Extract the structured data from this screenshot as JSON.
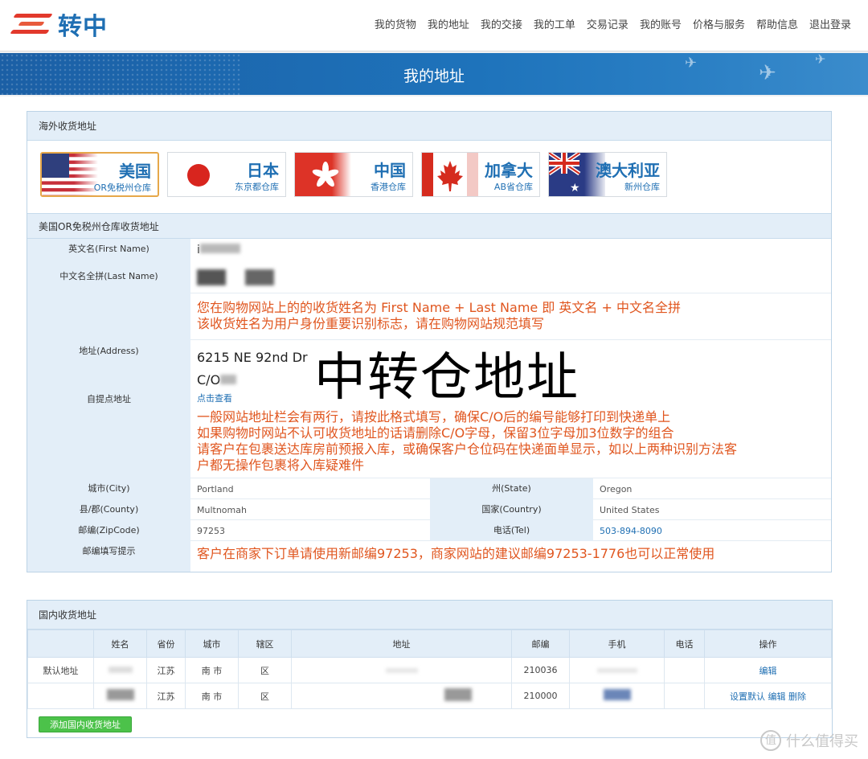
{
  "brand": {
    "name": "转中",
    "logo_color": "#1f6fb3",
    "accent": "#e2392c"
  },
  "nav": [
    "我的货物",
    "我的地址",
    "我的交接",
    "我的工单",
    "交易记录",
    "我的账号",
    "价格与服务",
    "帮助信息",
    "退出登录"
  ],
  "banner": {
    "title": "我的地址"
  },
  "overseas": {
    "heading": "海外收货地址",
    "warehouses": [
      {
        "name": "美国",
        "sub": "OR免税州仓库",
        "flag_icon": "us-flag-icon",
        "active": true
      },
      {
        "name": "日本",
        "sub": "东京都仓库",
        "flag_icon": "japan-flag-icon",
        "active": false
      },
      {
        "name": "中国",
        "sub": "香港仓库",
        "flag_icon": "hongkong-flag-icon",
        "active": false
      },
      {
        "name": "加拿大",
        "sub": "AB省仓库",
        "flag_icon": "canada-flag-icon",
        "active": false
      },
      {
        "name": "澳大利亚",
        "sub": "新州仓库",
        "flag_icon": "australia-flag-icon",
        "active": false
      }
    ],
    "address_heading": "美国OR免税州仓库收货地址",
    "labels": {
      "first_name": "英文名(First Name)",
      "last_name": "中文名全拼(Last Name)",
      "address": "地址(Address)",
      "pickup": "自提点地址",
      "city": "城市(City)",
      "state": "州(State)",
      "county": "县/郡(County)",
      "country": "国家(Country)",
      "zip": "邮编(ZipCode)",
      "tel": "电话(Tel)",
      "zip_tip": "邮编填写提示"
    },
    "values": {
      "first_name": "i",
      "address_line1": "6215 NE 92nd Dr",
      "address_line2": "C/O",
      "pickup_link": "点击查看",
      "city": "Portland",
      "state": "Oregon",
      "county": "Multnomah",
      "country": "United States",
      "zip": "97253",
      "tel": "503-894-8090"
    },
    "notes": {
      "name_note_1": "您在购物网站上的的收货姓名为 First Name + Last Name 即 英文名 + 中文名全拼",
      "name_note_2": "该收货姓名为用户身份重要识别标志，请在购物网站规范填写",
      "addr_note_1": "一般网站地址栏会有两行，请按此格式填写，确保C/O后的编号能够打印到快递单上",
      "addr_note_2": "如果购物时网站不认可收货地址的话请删除C/O字母，保留3位字母加3位数字的组合",
      "addr_note_3": "请客户在包裹送达库房前预报入库，或确保客户仓位码在快递面单显示，如以上两种识别方法客",
      "addr_note_4": "户都无操作包裹将入库疑难件",
      "zip_note": "客户在商家下订单请使用新邮编97253，商家网站的建议邮编97253-1776也可以正常使用"
    },
    "overlay_caption": "中转仓地址"
  },
  "domestic": {
    "heading": "国内收货地址",
    "columns": [
      "",
      "姓名",
      "省份",
      "城市",
      "辖区",
      "地址",
      "邮编",
      "手机",
      "电话",
      "操作"
    ],
    "rows": [
      {
        "tag": "默认地址",
        "province": "江苏",
        "city": "南 市",
        "district": "区",
        "zip": "210036",
        "actions": [
          "编辑"
        ]
      },
      {
        "tag": "",
        "province": "江苏",
        "city": "南 市",
        "district": "区",
        "zip": "210000",
        "actions": [
          "设置默认",
          "编辑",
          "删除"
        ]
      }
    ],
    "add_button": "添加国内收货地址"
  },
  "watermark": {
    "badge": "值",
    "text": "什么值得买"
  }
}
